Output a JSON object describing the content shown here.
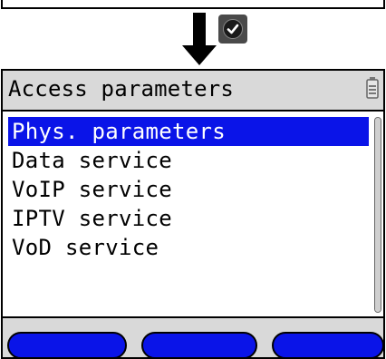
{
  "screen": {
    "title": "Access parameters",
    "battery_icon": "battery-icon",
    "menu": {
      "items": [
        {
          "label": "Phys. parameters",
          "selected": true
        },
        {
          "label": "Data service",
          "selected": false
        },
        {
          "label": "VoIP service",
          "selected": false
        },
        {
          "label": "IPTV service",
          "selected": false
        },
        {
          "label": "VoD service",
          "selected": false
        }
      ]
    },
    "softkeys": [
      {
        "label": ""
      },
      {
        "label": ""
      },
      {
        "label": ""
      }
    ]
  },
  "annotation": {
    "arrow_icon": "down-arrow-icon",
    "confirm_icon": "checkmark-icon"
  },
  "colors": {
    "selection": "#0a14e8",
    "panel": "#d9d9d9",
    "softkey": "#0a14e8"
  }
}
